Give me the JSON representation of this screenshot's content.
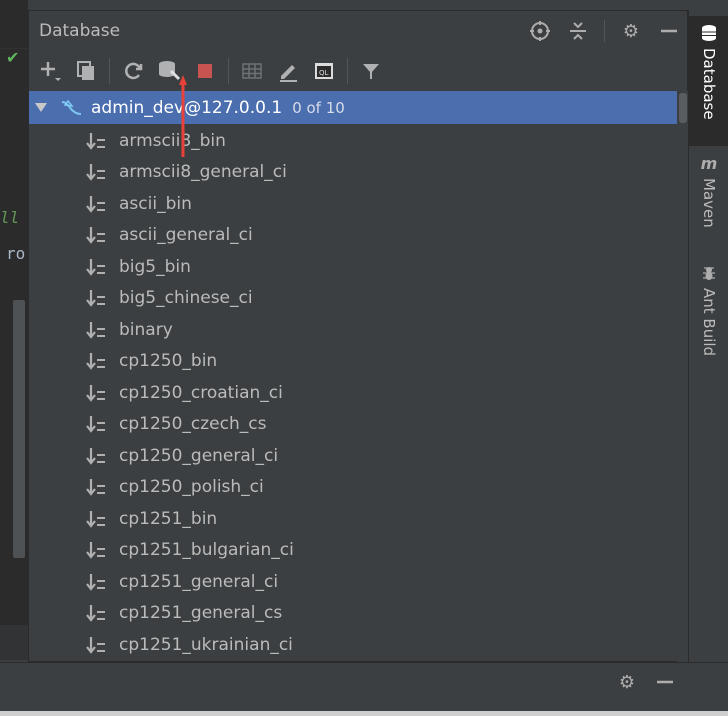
{
  "editor": {
    "fragment_1": "ll",
    "fragment_2": "ro"
  },
  "panel": {
    "title": "Database"
  },
  "toolbar": {
    "icons": [
      "add-icon",
      "copy-icon",
      "refresh-icon",
      "properties-icon",
      "stop-icon",
      "table-icon",
      "edit-icon",
      "sql-console-icon",
      "filter-icon"
    ]
  },
  "tree": {
    "root": {
      "name": "admin_dev@127.0.0.1",
      "count": "0 of 10"
    },
    "items": [
      "armscii8_bin",
      "armscii8_general_ci",
      "ascii_bin",
      "ascii_general_ci",
      "big5_bin",
      "big5_chinese_ci",
      "binary",
      "cp1250_bin",
      "cp1250_croatian_ci",
      "cp1250_czech_cs",
      "cp1250_general_ci",
      "cp1250_polish_ci",
      "cp1251_bin",
      "cp1251_bulgarian_ci",
      "cp1251_general_ci",
      "cp1251_general_cs",
      "cp1251_ukrainian_ci"
    ]
  },
  "right_tabs": {
    "database": "Database",
    "maven": "Maven",
    "ant": "Ant Build"
  },
  "colors": {
    "selection": "#4b6eaf",
    "panel_bg": "#3c3f41",
    "accent_red": "#e8413c"
  }
}
